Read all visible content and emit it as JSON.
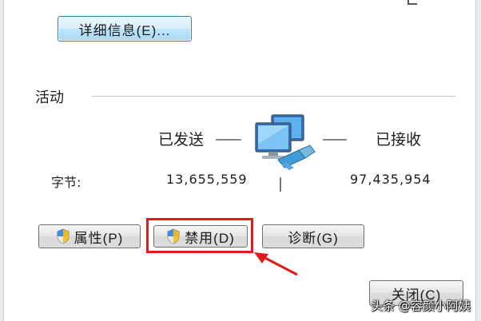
{
  "dialog": {
    "details_button": "详细信息(E)...",
    "activity_group_label": "活动",
    "sent_label": "已发送",
    "received_label": "已接收",
    "bytes_label": "字节:",
    "bytes_sent": "13,655,559",
    "bytes_received": "97,435,954",
    "properties_button": "属性(P)",
    "disable_button": "禁用(D)",
    "diagnose_button": "诊断(G)",
    "close_button": "关闭(C)"
  },
  "annotation": {
    "highlight_color": "#e01b1b",
    "arrow_color": "#e01b1b"
  },
  "watermark": {
    "text": "头条 @容颜小阿姨"
  },
  "icons": {
    "network": "network-connection-icon",
    "shield": "uac-shield-icon"
  }
}
